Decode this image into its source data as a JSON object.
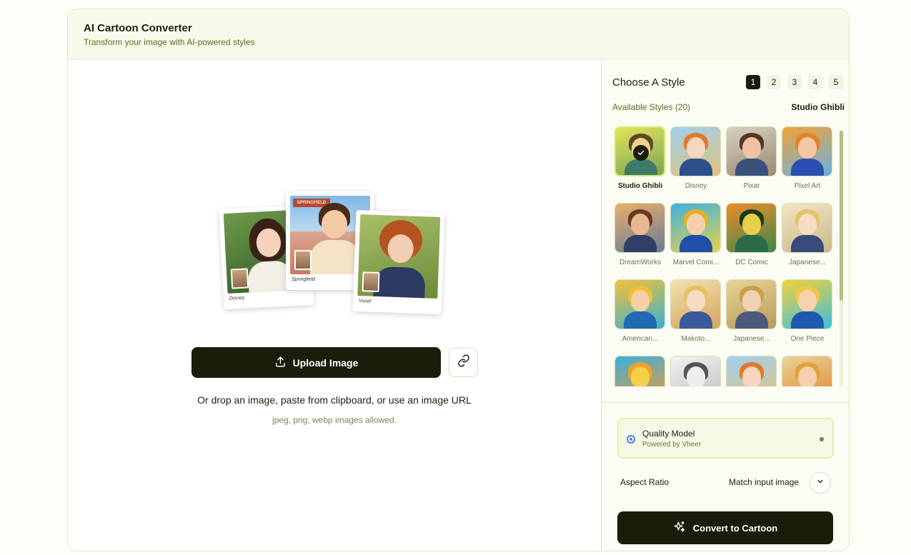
{
  "header": {
    "title": "AI Cartoon Converter",
    "subtitle": "Transform your image with AI-powered styles"
  },
  "upload": {
    "illustration_captions": [
      "Disney",
      "Springfield",
      "Voxel"
    ],
    "illustration_sign": "SPRINGFIELD",
    "upload_label": "Upload Image",
    "drop_text": "Or drop an image, paste from clipboard, or use an image URL",
    "allowed_text": "jpeg, png, webp images allowed.",
    "icons": {
      "upload": "upload-icon",
      "link": "link-icon"
    }
  },
  "styles_panel": {
    "title": "Choose A Style",
    "pages": [
      "1",
      "2",
      "3",
      "4",
      "5"
    ],
    "active_page": "1",
    "available_label": "Available Styles (20)",
    "selected_style": "Studio Ghibli",
    "styles": [
      {
        "label": "Studio Ghibli",
        "selected": true
      },
      {
        "label": "Disney",
        "selected": false
      },
      {
        "label": "Pixar",
        "selected": false
      },
      {
        "label": "Pixel Art",
        "selected": false
      },
      {
        "label": "DreamWorks",
        "selected": false
      },
      {
        "label": "Marvel Comi...",
        "selected": false
      },
      {
        "label": "DC Comic",
        "selected": false
      },
      {
        "label": "Japanese...",
        "selected": false
      },
      {
        "label": "American...",
        "selected": false
      },
      {
        "label": "Makoto...",
        "selected": false
      },
      {
        "label": "Japanese...",
        "selected": false
      },
      {
        "label": "One Piece",
        "selected": false
      },
      {
        "label": "",
        "selected": false
      },
      {
        "label": "",
        "selected": false
      },
      {
        "label": "",
        "selected": false
      },
      {
        "label": "",
        "selected": false
      }
    ]
  },
  "model": {
    "name": "Quality Model",
    "powered_by": "Powered by Vheer"
  },
  "aspect": {
    "label": "Aspect Ratio",
    "value": "Match input image"
  },
  "convert": {
    "label": "Convert to Cartoon",
    "icon": "sparkle-icon"
  },
  "colors": {
    "accent_dark": "#1c1c0a",
    "header_bg": "#f7faeb",
    "selected_border": "#d5ec5c",
    "radio_blue": "#3b82f6"
  }
}
